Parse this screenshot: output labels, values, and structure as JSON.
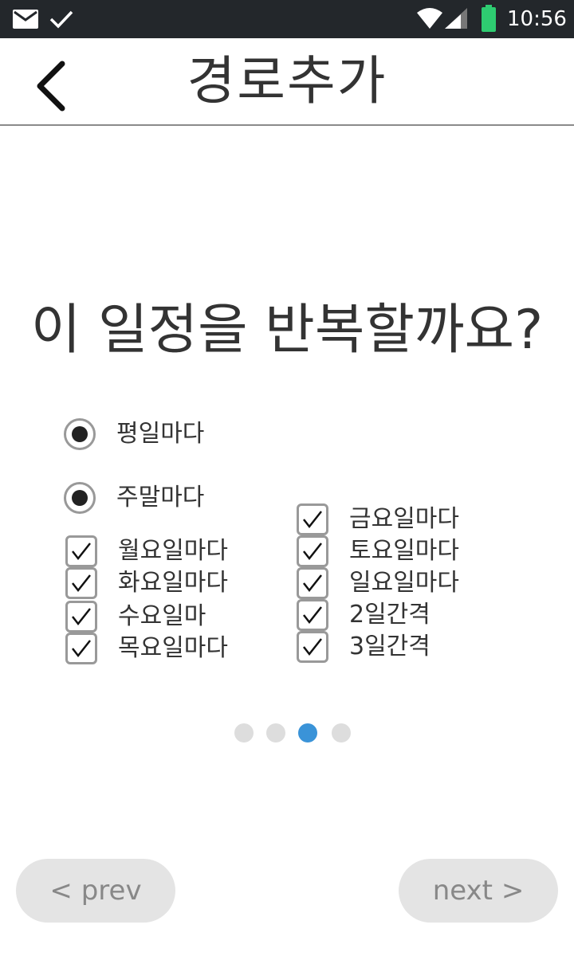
{
  "status_bar": {
    "time": "10:56",
    "icons": [
      "mail-icon",
      "check-icon",
      "wifi-icon",
      "signal-icon",
      "battery-icon"
    ],
    "battery_color": "#2ecc71"
  },
  "header": {
    "title": "경로추가",
    "back_icon": "chevron-left-icon"
  },
  "question": "이 일정을 반복할까요?",
  "radio_options": [
    {
      "label": "평일마다",
      "selected": true
    },
    {
      "label": "주말마다",
      "selected": true
    }
  ],
  "checkbox_left": [
    {
      "label": "월요일마다",
      "checked": true
    },
    {
      "label": "화요일마다",
      "checked": true
    },
    {
      "label": "수요일마",
      "checked": true
    },
    {
      "label": "목요일마다",
      "checked": true
    }
  ],
  "checkbox_right": [
    {
      "label": "금요일마다",
      "checked": true
    },
    {
      "label": "토요일마다",
      "checked": true
    },
    {
      "label": "일요일마다",
      "checked": true
    },
    {
      "label": "2일간격",
      "checked": true
    },
    {
      "label": "3일간격",
      "checked": true
    }
  ],
  "pagination": {
    "total": 4,
    "current": 3,
    "active_color": "#3a93d8"
  },
  "buttons": {
    "prev_label": "< prev",
    "next_label": "next >"
  }
}
